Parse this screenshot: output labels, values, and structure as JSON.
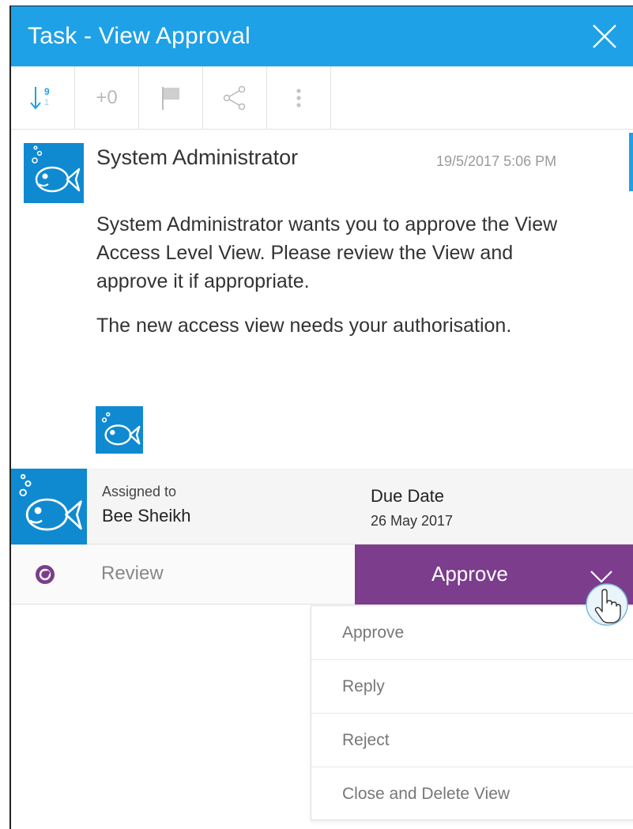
{
  "header": {
    "title": "Task - View Approval"
  },
  "toolbar": {
    "sort_icon": "sort-down-icon",
    "sort_top": "9",
    "sort_bottom": "1",
    "plus_count": "+0",
    "flag_icon": "flag-icon",
    "share_icon": "share-icon",
    "more_icon": "more-vertical-icon"
  },
  "message": {
    "sender": "System Administrator",
    "timestamp": "19/5/2017 5:06 PM",
    "paragraphs": [
      "System Administrator wants you to approve the View Access Level View. Please review the View and approve it if appropriate.",
      "The new access view needs your authorisation."
    ]
  },
  "assignment": {
    "assigned_label": "Assigned to",
    "assigned_name": "Bee Sheikh",
    "due_label": "Due Date",
    "due_date": "26 May 2017"
  },
  "action": {
    "status_label": "Review",
    "primary_label": "Approve"
  },
  "dropdown": {
    "items": [
      "Approve",
      "Reply",
      "Reject",
      "Close and Delete View"
    ]
  },
  "colors": {
    "header_bg": "#1ea1e6",
    "approve_bg": "#7b3d8c",
    "avatar_bg": "#0f8ad1",
    "toolbar_icon": "#1ea1e6"
  }
}
